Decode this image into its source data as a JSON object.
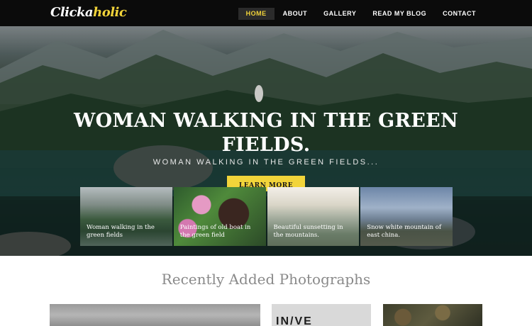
{
  "brand": {
    "logo_white": "Clicka",
    "logo_yellow": "holic"
  },
  "nav": {
    "items": [
      {
        "label": "HOME",
        "active": true
      },
      {
        "label": "ABOUT",
        "active": false
      },
      {
        "label": "GALLERY",
        "active": false
      },
      {
        "label": "READ MY BLOG",
        "active": false
      },
      {
        "label": "CONTACT",
        "active": false
      }
    ]
  },
  "hero": {
    "title_line1": "WOMAN WALKING IN THE GREEN",
    "title_line2": "FIELDS.",
    "subtitle": "WOMAN WALKING IN THE GREEN FIELDS...",
    "button_label": "LEARN MORE"
  },
  "thumbnails": [
    {
      "caption_line1": "Woman walking in the",
      "caption_line2": "green fields"
    },
    {
      "caption_line1": "Paintings of old boat in",
      "caption_line2": "the green field"
    },
    {
      "caption_line1": "Beautiful sunsetting in",
      "caption_line2": "the mountains."
    },
    {
      "caption_line1": "Snow white mountain of",
      "caption_line2": "east china."
    }
  ],
  "section": {
    "title": "Recently Added Photographs"
  },
  "gallery": {
    "text_fragment": "IN/VE"
  },
  "colors": {
    "accent": "#f2d43a",
    "nav_bg": "#0b0b0b",
    "active_bg": "#2b2b2b"
  }
}
